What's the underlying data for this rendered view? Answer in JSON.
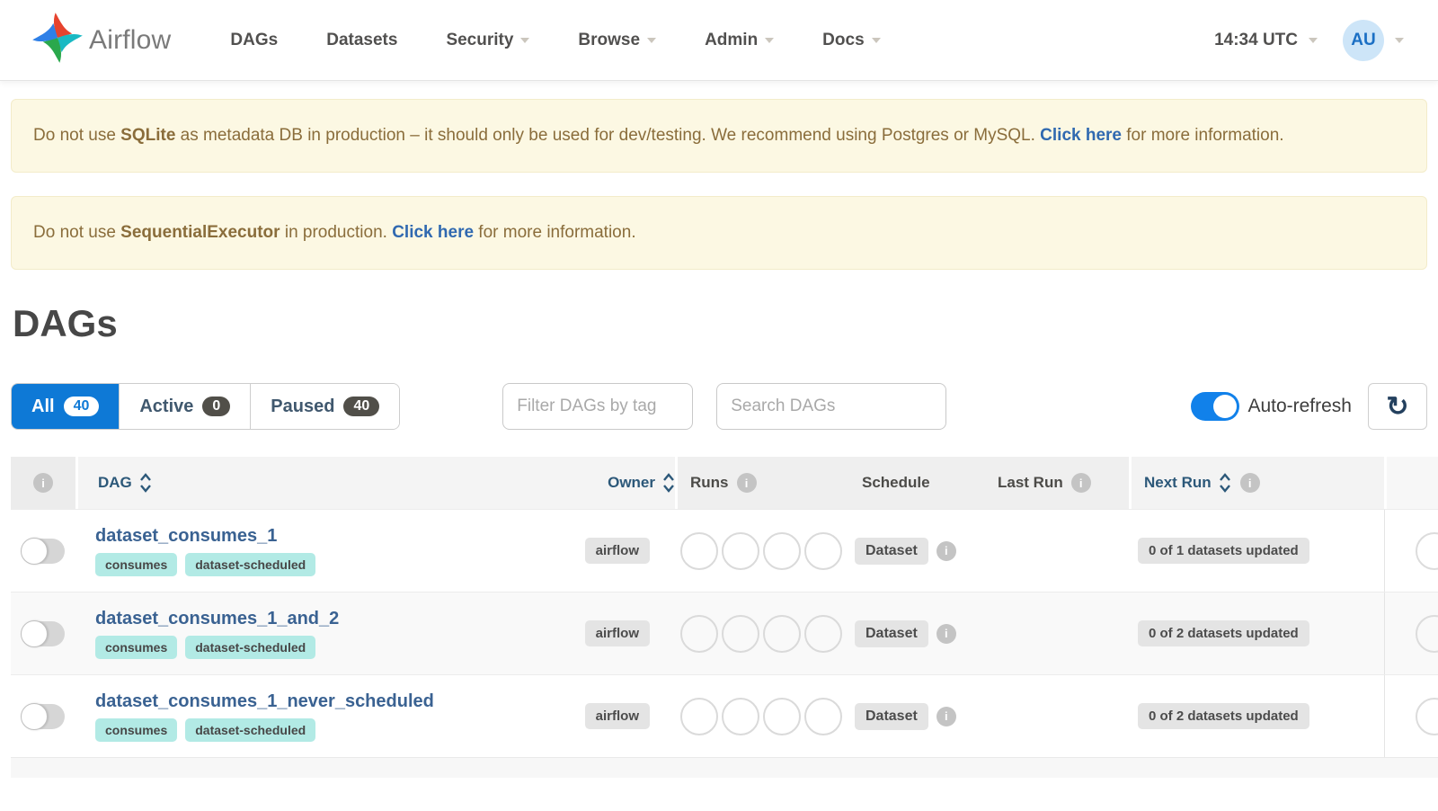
{
  "nav": {
    "brand": "Airflow",
    "items": [
      {
        "label": "DAGs",
        "has_caret": false
      },
      {
        "label": "Datasets",
        "has_caret": false
      },
      {
        "label": "Security",
        "has_caret": true
      },
      {
        "label": "Browse",
        "has_caret": true
      },
      {
        "label": "Admin",
        "has_caret": true
      },
      {
        "label": "Docs",
        "has_caret": true
      }
    ],
    "time": "14:34 UTC",
    "avatar_initials": "AU"
  },
  "alerts": [
    {
      "parts": {
        "p0": "Do not use ",
        "p1": "SQLite",
        "p2": " as metadata DB in production – it should only be used for dev/testing. We recommend using Postgres or MySQL. ",
        "link": "Click here",
        "p4": " for more information."
      }
    },
    {
      "parts": {
        "p0": "Do not use ",
        "p1": "SequentialExecutor",
        "p2": " in production. ",
        "link": "Click here",
        "p4": " for more information."
      }
    }
  ],
  "page": {
    "title": "DAGs"
  },
  "filters": {
    "tabs": [
      {
        "label": "All",
        "count": "40",
        "active": true
      },
      {
        "label": "Active",
        "count": "0",
        "active": false
      },
      {
        "label": "Paused",
        "count": "40",
        "active": false
      }
    ],
    "tag_filter_placeholder": "Filter DAGs by tag",
    "search_placeholder": "Search DAGs",
    "auto_refresh_label": "Auto-refresh",
    "auto_refresh_on": true,
    "refresh_icon": "↻"
  },
  "table": {
    "columns": {
      "dag": "DAG",
      "owner": "Owner",
      "runs": "Runs",
      "schedule": "Schedule",
      "last_run": "Last Run",
      "next_run": "Next Run"
    },
    "info_icon_glyph": "i",
    "rows": [
      {
        "name": "dataset_consumes_1",
        "tags": {
          "t0": "consumes",
          "t1": "dataset-scheduled"
        },
        "owner": "airflow",
        "schedule": "Dataset",
        "last_run": "",
        "next_run": "0 of 1 datasets updated",
        "paused": true
      },
      {
        "name": "dataset_consumes_1_and_2",
        "tags": {
          "t0": "consumes",
          "t1": "dataset-scheduled"
        },
        "owner": "airflow",
        "schedule": "Dataset",
        "last_run": "",
        "next_run": "0 of 2 datasets updated",
        "paused": true
      },
      {
        "name": "dataset_consumes_1_never_scheduled",
        "tags": {
          "t0": "consumes",
          "t1": "dataset-scheduled"
        },
        "owner": "airflow",
        "schedule": "Dataset",
        "last_run": "",
        "next_run": "0 of 2 datasets updated",
        "paused": true
      }
    ]
  },
  "colors": {
    "accent_blue": "#0e79d6",
    "toggle_blue": "#1181ea",
    "link_blue": "#3069b0",
    "dag_link_blue": "#3a6292",
    "header_sort_blue": "#2c5879",
    "warning_bg": "#fcf8e3",
    "warning_text": "#8a6d3b",
    "tag_teal": "#b2eae5",
    "badge_gray": "#e4e4e4",
    "avatar_bg": "#cde5f8",
    "avatar_text": "#1b6fc4"
  }
}
